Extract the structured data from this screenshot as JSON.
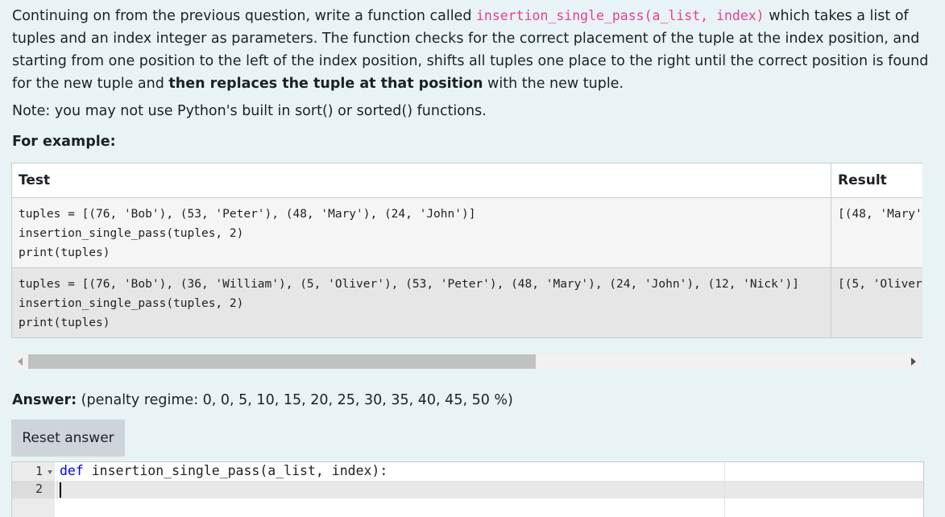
{
  "question": {
    "intro": "Continuing on from the previous question, write a function called ",
    "func_name": "insertion_single_pass(a_list, index)",
    "desc_a": " which takes a list of tuples and an index integer as parameters. The function checks for the correct placement of the tuple at the index position, and starting from one position to the left of the index position, shifts all tuples one place to the right until the correct position is found for the new tuple and ",
    "desc_bold": "then replaces the tuple at that position",
    "desc_b": " with the new tuple.",
    "note": "Note: you may not use Python's built in sort() or sorted() functions.",
    "for_example": "For example:"
  },
  "table": {
    "headers": [
      "Test",
      "Result"
    ],
    "rows": [
      {
        "test": "tuples = [(76, 'Bob'), (53, 'Peter'), (48, 'Mary'), (24, 'John')]\ninsertion_single_pass(tuples, 2)\nprint(tuples)",
        "result": "[(48, 'Mary'"
      },
      {
        "test": "tuples = [(76, 'Bob'), (36, 'William'), (5, 'Oliver'), (53, 'Peter'), (48, 'Mary'), (24, 'John'), (12, 'Nick')]\ninsertion_single_pass(tuples, 2)\nprint(tuples)",
        "result": "[(5, 'Oliver"
      }
    ]
  },
  "answer": {
    "label": "Answer:",
    "penalty": "(penalty regime: 0, 0, 5, 10, 15, 20, 25, 30, 35, 40, 45, 50 %)",
    "reset_label": "Reset answer"
  },
  "editor": {
    "line_numbers": [
      "1",
      "2"
    ],
    "keyword": "def",
    "line1_rest": " insertion_single_pass(a_list, index):",
    "line2": ""
  }
}
